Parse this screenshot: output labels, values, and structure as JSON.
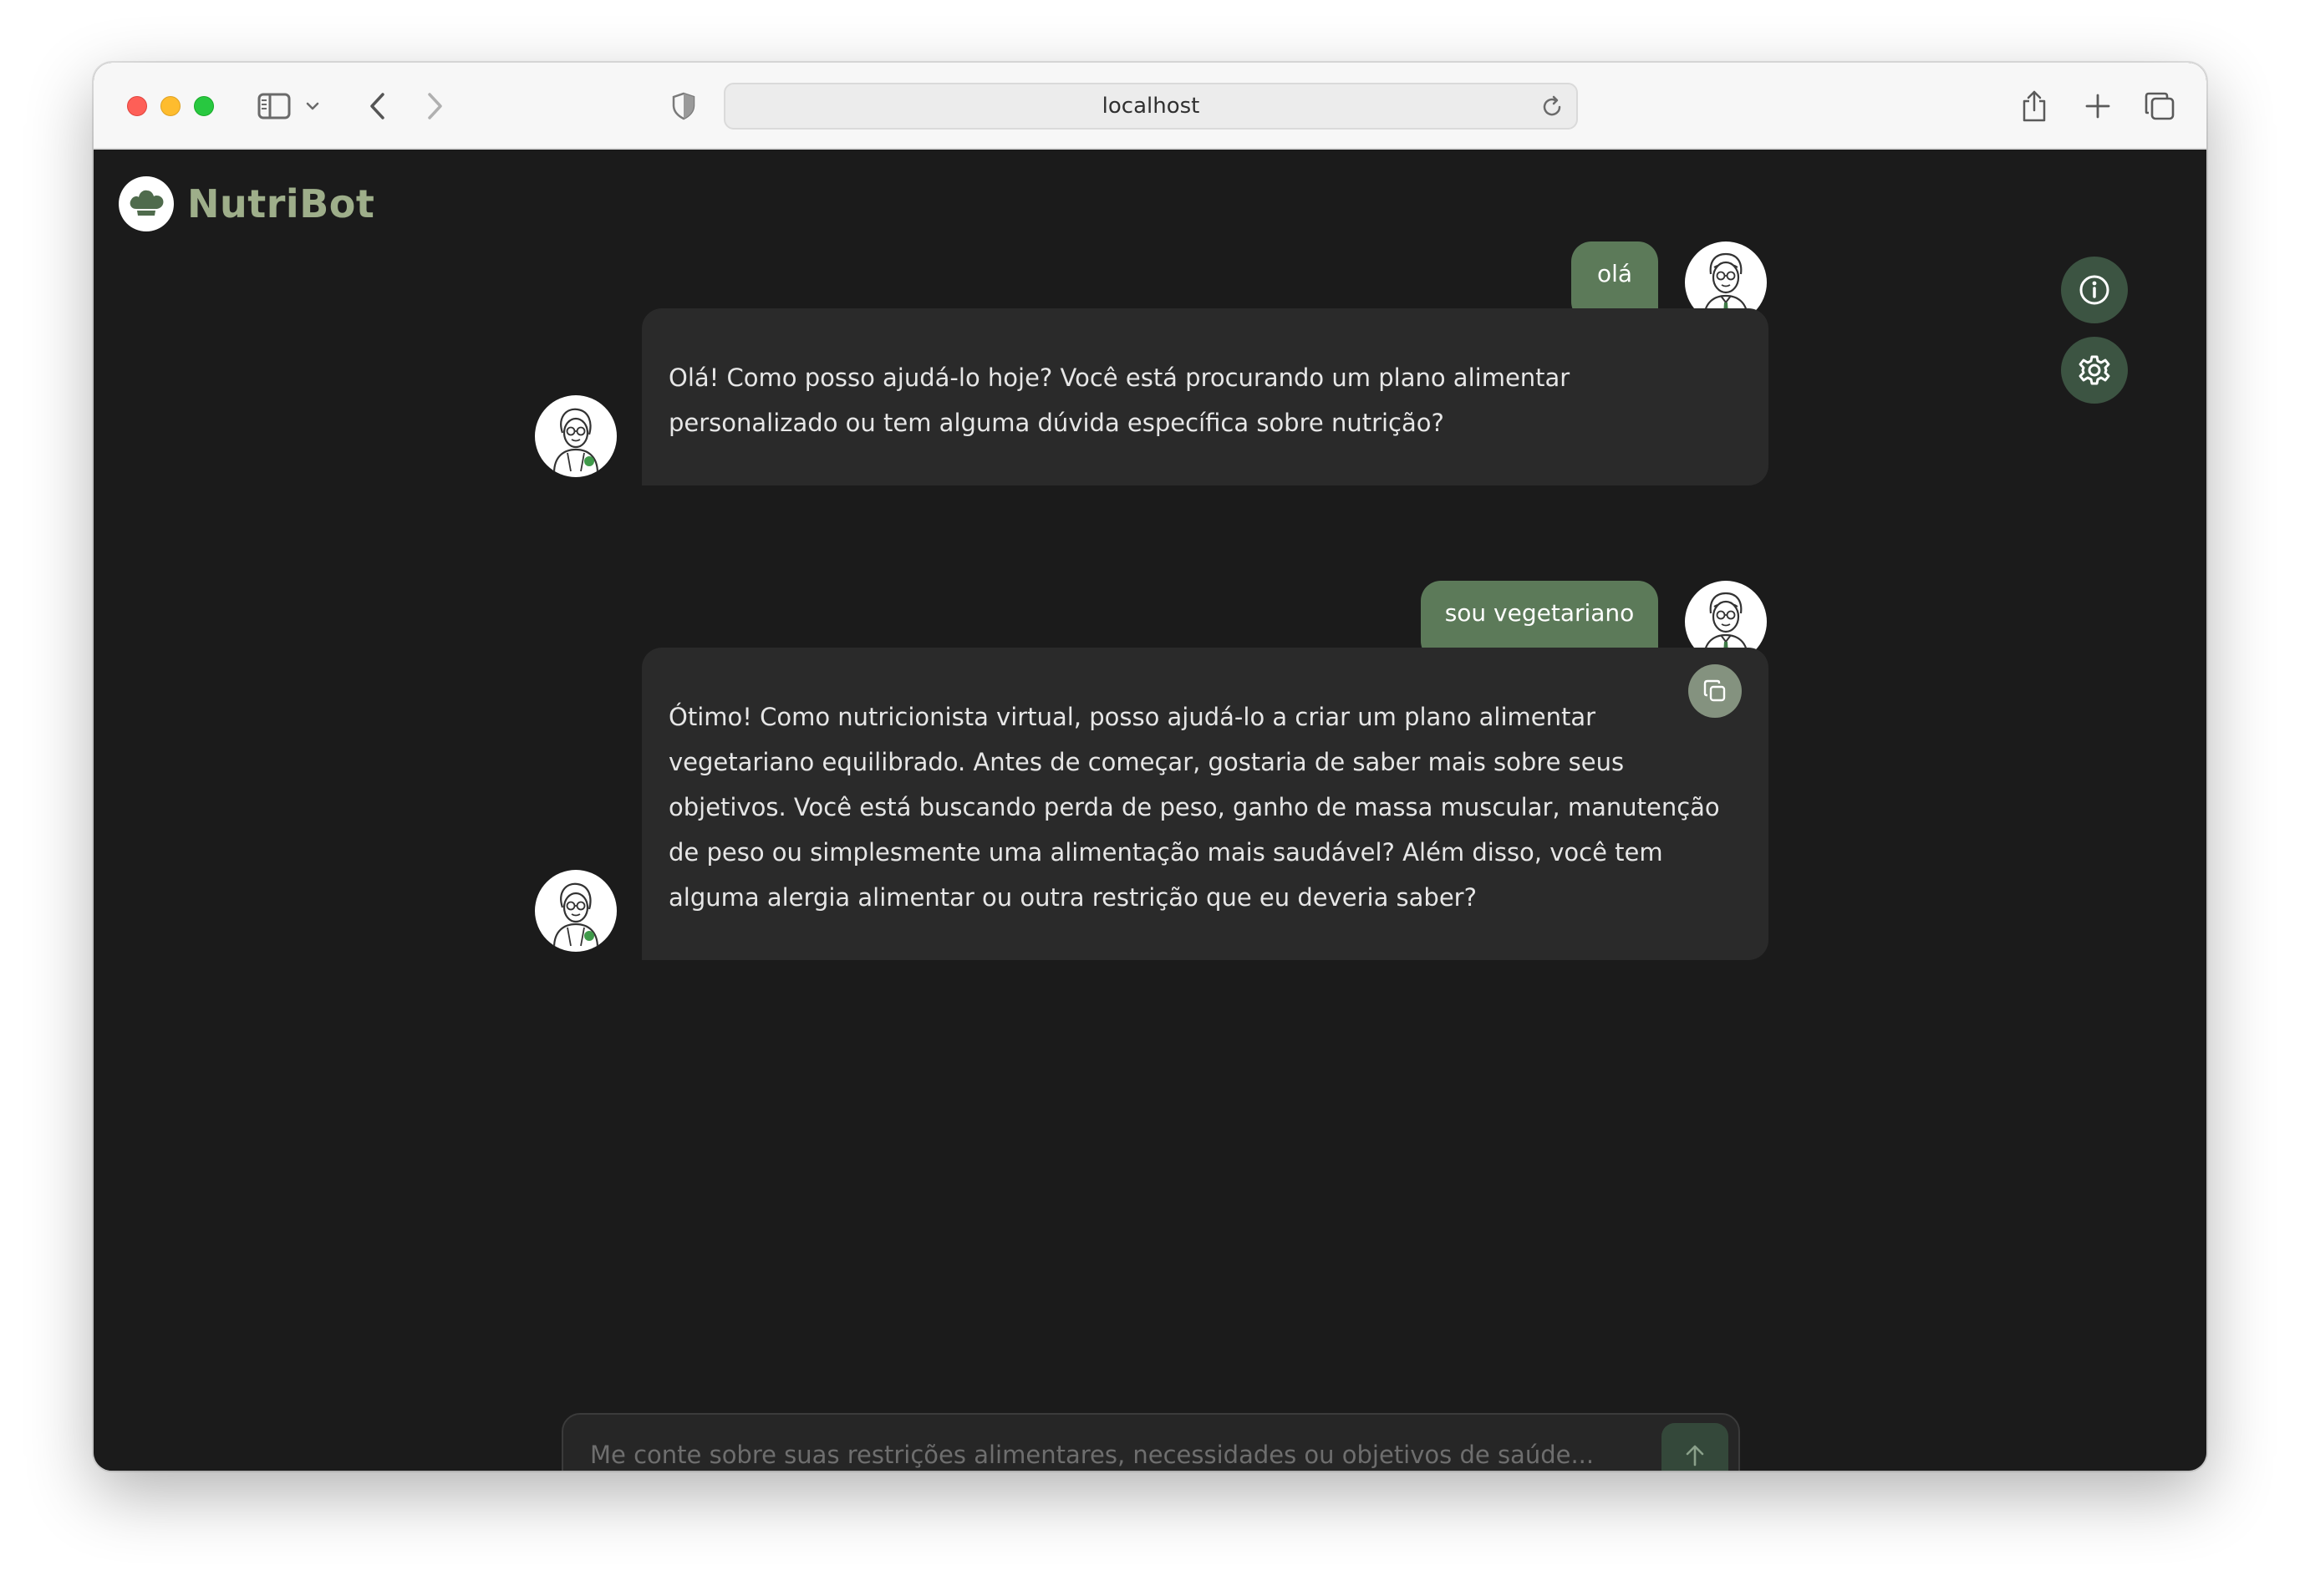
{
  "browser": {
    "url": "localhost"
  },
  "app": {
    "name": "NutriBot"
  },
  "messages": [
    {
      "role": "user",
      "text": "olá"
    },
    {
      "role": "bot",
      "text": "Olá! Como posso ajudá-lo hoje? Você está procurando um plano alimentar personalizado ou tem alguma dúvida específica sobre nutrição?"
    },
    {
      "role": "user",
      "text": "sou vegetariano"
    },
    {
      "role": "bot",
      "text": "Ótimo! Como nutricionista virtual, posso ajudá-lo a criar um plano alimentar vegetariano equilibrado. Antes de começar, gostaria de saber mais sobre seus objetivos. Você está buscando perda de peso, ganho de massa muscular, manutenção de peso ou simplesmente uma alimentação mais saudável? Além disso, você tem alguma alergia alimentar ou outra restrição que eu deveria saber?"
    }
  ],
  "composer": {
    "placeholder": "Me conte sobre suas restrições alimentares, necessidades ou objetivos de saúde..."
  },
  "colors": {
    "background": "#1b1b1b",
    "brand": "#9eae8a",
    "user_bubble": "#5c7a59",
    "bot_bubble": "#2a2a2a",
    "fab": "#3c5442"
  }
}
